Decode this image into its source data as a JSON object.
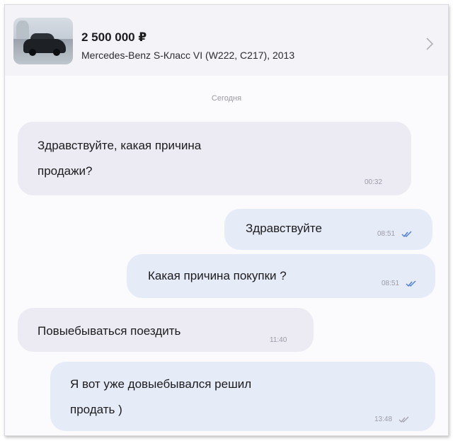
{
  "listing": {
    "price": "2 500 000 ₽",
    "title": "Mercedes-Benz S-Класс VI (W222, C217), 2013"
  },
  "chat": {
    "date_label": "Сегодня",
    "messages": [
      {
        "direction": "incoming",
        "text": "Здравствуйте, какая причина\nпродажи?",
        "time": "00:32"
      },
      {
        "direction": "outgoing",
        "text": "Здравствуйте",
        "time": "08:51",
        "read": true
      },
      {
        "direction": "outgoing",
        "text": "Какая причина покупки ?",
        "time": "08:51",
        "read": true
      },
      {
        "direction": "incoming",
        "text": "Повыебываться поездить",
        "time": "11:40"
      },
      {
        "direction": "outgoing",
        "text": "Я вот уже довыебывался решил\nпродать )",
        "time": "13:48",
        "read": false
      }
    ]
  },
  "colors": {
    "incoming_bubble": "#ecebf3",
    "outgoing_bubble": "#e6ebf8",
    "read_ticks": "#4a7bd8",
    "unread_ticks": "#a4a4ae"
  },
  "icons": {
    "listing_chevron": "chevron-right-icon",
    "read_receipt": "double-check-icon"
  }
}
